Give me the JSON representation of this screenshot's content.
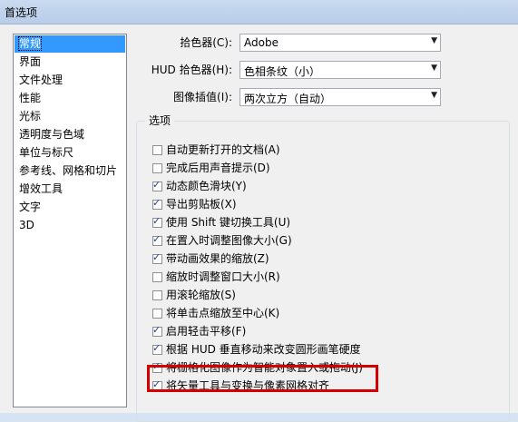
{
  "window": {
    "title": "首选项"
  },
  "sidebar": {
    "items": [
      {
        "label": "常规",
        "selected": true
      },
      {
        "label": "界面"
      },
      {
        "label": "文件处理"
      },
      {
        "label": "性能"
      },
      {
        "label": "光标"
      },
      {
        "label": "透明度与色域"
      },
      {
        "label": "单位与标尺"
      },
      {
        "label": "参考线、网格和切片"
      },
      {
        "label": "增效工具"
      },
      {
        "label": "文字"
      },
      {
        "label": "3D"
      }
    ]
  },
  "fields": {
    "color_picker": {
      "label": "拾色器(C):",
      "value": "Adobe"
    },
    "hud_color_picker": {
      "label": "HUD 拾色器(H):",
      "value": "色相条纹（小）"
    },
    "interpolation": {
      "label": "图像插值(I):",
      "value": "两次立方（自动）"
    }
  },
  "options": {
    "legend": "选项",
    "items": [
      {
        "label": "自动更新打开的文档(A)",
        "checked": false
      },
      {
        "label": "完成后用声音提示(D)",
        "checked": false
      },
      {
        "label": "动态颜色滑块(Y)",
        "checked": true
      },
      {
        "label": "导出剪贴板(X)",
        "checked": true
      },
      {
        "label": "使用 Shift 键切换工具(U)",
        "checked": true
      },
      {
        "label": "在置入时调整图像大小(G)",
        "checked": true
      },
      {
        "label": "带动画效果的缩放(Z)",
        "checked": true
      },
      {
        "label": "缩放时调整窗口大小(R)",
        "checked": false
      },
      {
        "label": "用滚轮缩放(S)",
        "checked": false
      },
      {
        "label": "将单击点缩放至中心(K)",
        "checked": false
      },
      {
        "label": "启用轻击平移(F)",
        "checked": true
      },
      {
        "label": "根据 HUD 垂直移动来改变圆形画笔硬度",
        "checked": true
      },
      {
        "label": "将栅格化图像作为智能对象置入或拖动(J)",
        "checked": true
      },
      {
        "label": "将矢量工具与变换与像素网格对齐",
        "checked": true
      }
    ]
  }
}
